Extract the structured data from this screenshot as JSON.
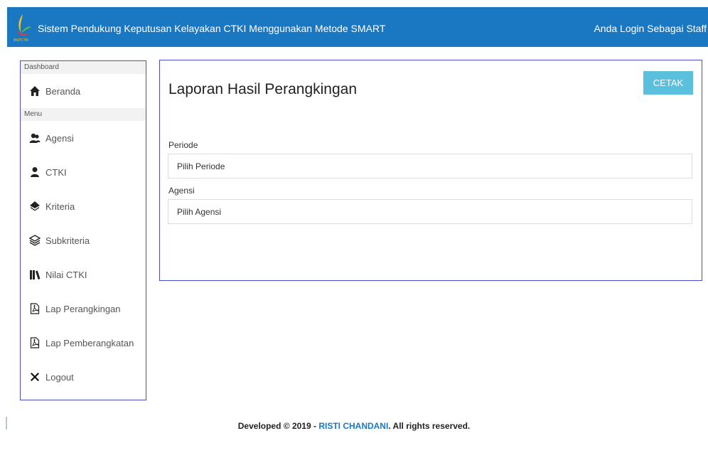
{
  "header": {
    "title": "Sistem Pendukung Keputusan Kelayakan CTKI Menggunakan Metode SMART",
    "login_status": "Anda Login Sebagai Staff",
    "logo_text": "BKPCTKI",
    "logo_icon": "org-logo-icon"
  },
  "sidebar": {
    "sections": [
      {
        "label": "Dashboard"
      },
      {
        "label": "Menu"
      }
    ],
    "items": [
      {
        "label": "Beranda",
        "icon": "home-icon"
      },
      {
        "label": "Agensi",
        "icon": "users-icon"
      },
      {
        "label": "CTKI",
        "icon": "user-icon"
      },
      {
        "label": "Kriteria",
        "icon": "diamond-icon"
      },
      {
        "label": "Subkriteria",
        "icon": "layers-icon"
      },
      {
        "label": "Nilai CTKI",
        "icon": "library-icon"
      },
      {
        "label": "Lap Perangkingan",
        "icon": "pdf-file-icon"
      },
      {
        "label": "Lap Pemberangkatan",
        "icon": "pdf-file-icon"
      },
      {
        "label": "Logout",
        "icon": "close-x-icon"
      }
    ]
  },
  "main": {
    "title": "Laporan Hasil Perangkingan",
    "print_button": "CETAK",
    "period_label": "Periode",
    "period_value": "Pilih Periode",
    "agency_label": "Agensi",
    "agency_value": "Pilih Agensi"
  },
  "footer": {
    "prefix": "Developed © 2019 - ",
    "author": "RISTI CHANDANI",
    "suffix": ". All rights reserved."
  },
  "colors": {
    "header_bg": "#1a78c2",
    "accent_button": "#5bc0de",
    "border": "#4b4bd6"
  }
}
